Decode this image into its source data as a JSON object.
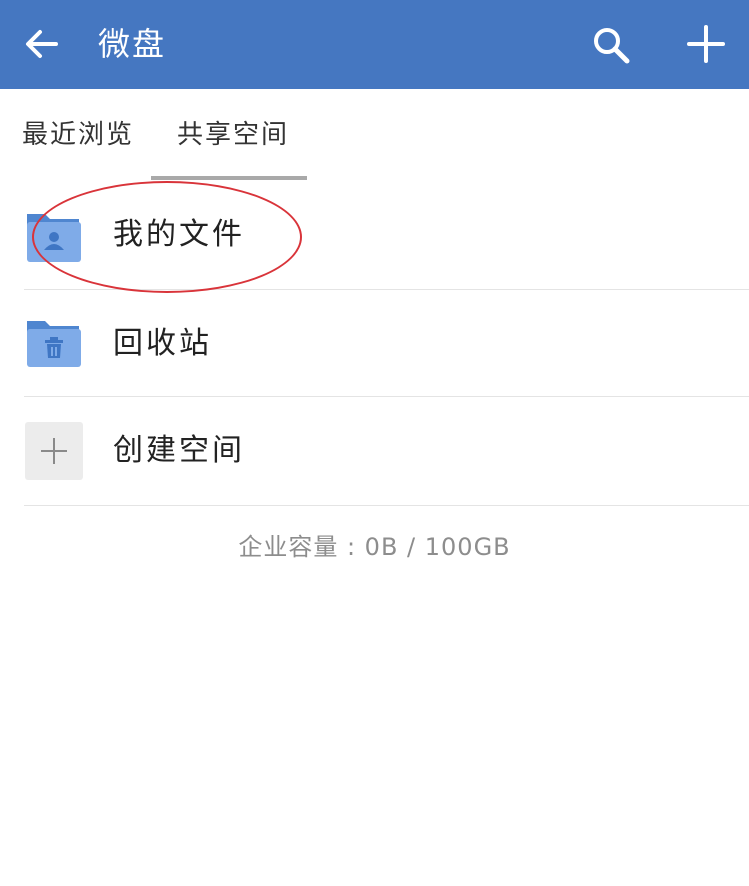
{
  "header": {
    "title": "微盘",
    "color": "#4577c1",
    "back_icon": "arrow-left-icon",
    "search_icon": "search-icon",
    "add_icon": "plus-icon"
  },
  "tabs": [
    {
      "label": "最近浏览",
      "active": false
    },
    {
      "label": "共享空间",
      "active": true
    }
  ],
  "list": [
    {
      "label": "我的文件",
      "icon": "user-folder-icon"
    },
    {
      "label": "回收站",
      "icon": "trash-folder-icon"
    },
    {
      "label": "创建空间",
      "icon": "plus-icon"
    }
  ],
  "footer": {
    "quota": "企业容量 : 0B / 100GB"
  }
}
